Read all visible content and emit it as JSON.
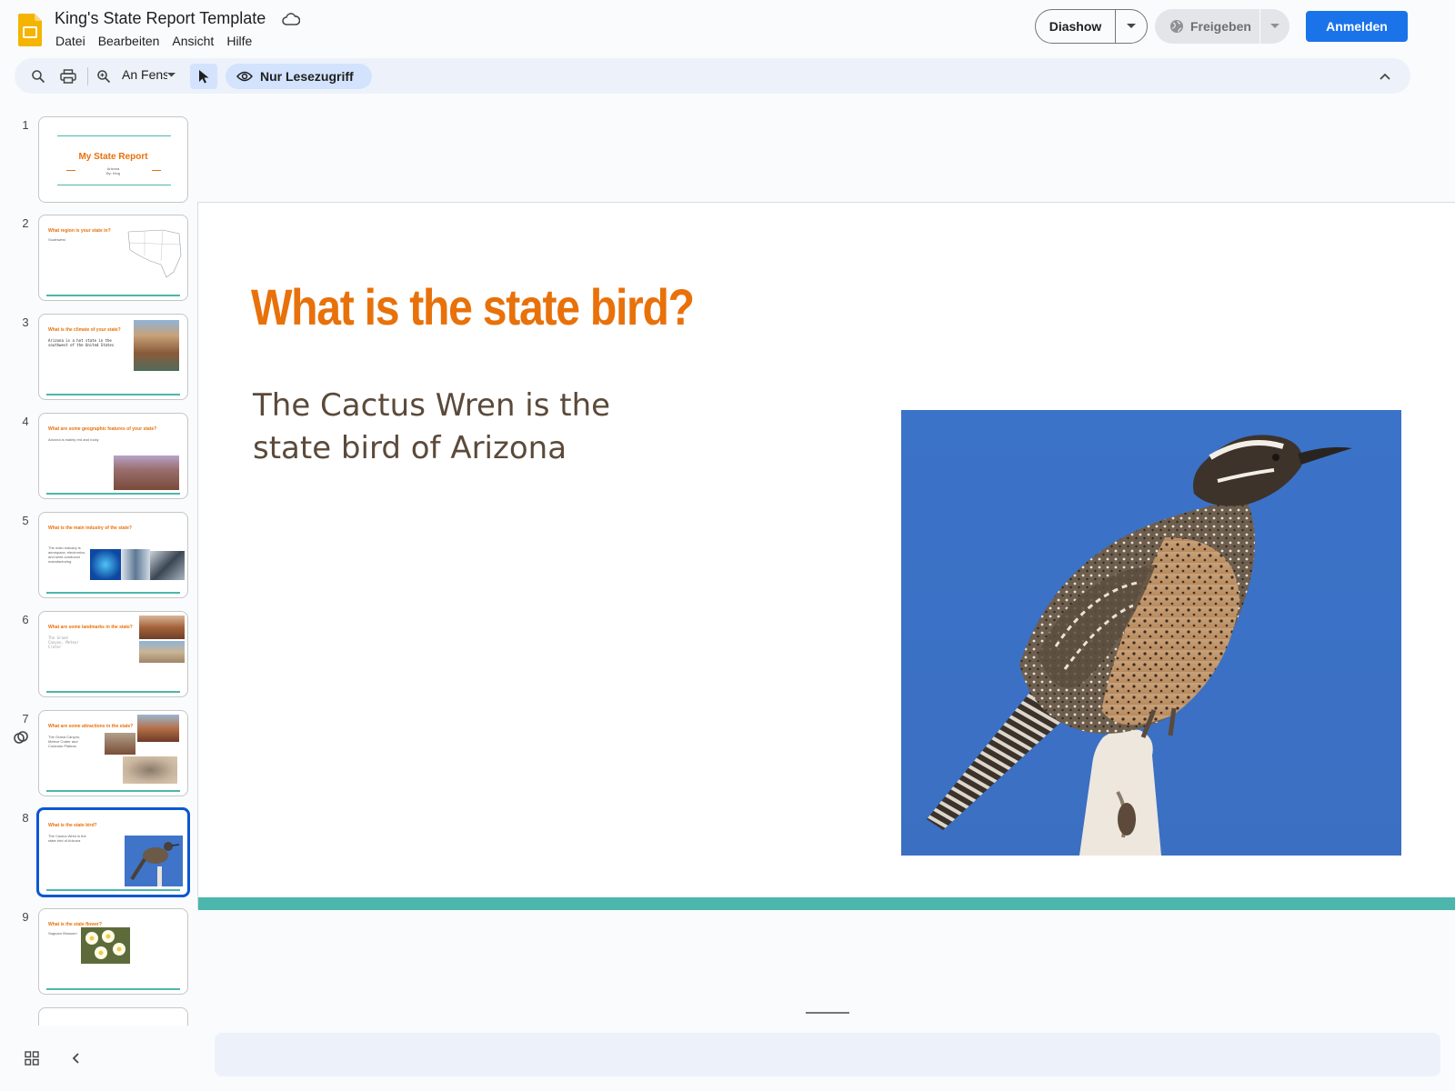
{
  "app": {
    "doc_title": "King's State Report Template",
    "menu": [
      "Datei",
      "Bearbeiten",
      "Ansicht",
      "Hilfe"
    ],
    "diashow_label": "Diashow",
    "share_label": "Freigeben",
    "signin_label": "Anmelden",
    "accent": "#1a73e8"
  },
  "toolbar": {
    "zoom_label": "An Fenster",
    "readonly_label": "Nur Lesezugriff",
    "icons": [
      "search-icon",
      "print-icon",
      "zoom-icon",
      "cursor-icon",
      "eye-icon",
      "chevron-up-icon"
    ]
  },
  "filmstrip": {
    "selected_slide": 8,
    "slides": [
      {
        "number": "1",
        "title": "My State Report",
        "body": [
          "Arizona",
          "By: King"
        ]
      },
      {
        "number": "2",
        "title": "What region is your state in?",
        "body": [
          "Southwest"
        ]
      },
      {
        "number": "3",
        "title": "What is the climate of your state?",
        "body": [
          "Arizona is a hot state in the southwest of the United States"
        ]
      },
      {
        "number": "4",
        "title": "What are some geographic features of your state?",
        "body": [
          "Arizona is mainly red and rocky"
        ]
      },
      {
        "number": "5",
        "title": "What is the main industry of the state?",
        "body": [
          "The main industry is aerospace, electronics, and semi-conductor manufacturing"
        ]
      },
      {
        "number": "6",
        "title": "What are some landmarks in the state?",
        "body": [
          "The Grand Canyon, Meteor Crater"
        ]
      },
      {
        "number": "7",
        "title": "What are some attractions in the state?",
        "body": [
          "The Grand Canyon, Meteor Crater and Colorado Plateau"
        ]
      },
      {
        "number": "8",
        "title": "What is the state bird?",
        "body": [
          "The Cactus Wren is the state bird of Arizona"
        ]
      },
      {
        "number": "9",
        "title": "What is the state flower?",
        "body": [
          "Saguaro Blossom"
        ]
      }
    ]
  },
  "slide": {
    "title": "What is the state bird?",
    "body_line1": "The Cactus Wren is the",
    "body_line2": "state bird of Arizona",
    "title_color": "#e8710a",
    "body_color": "#5b4a3a",
    "footer_color": "#4db6ac",
    "image": "cactus-wren-photo"
  }
}
